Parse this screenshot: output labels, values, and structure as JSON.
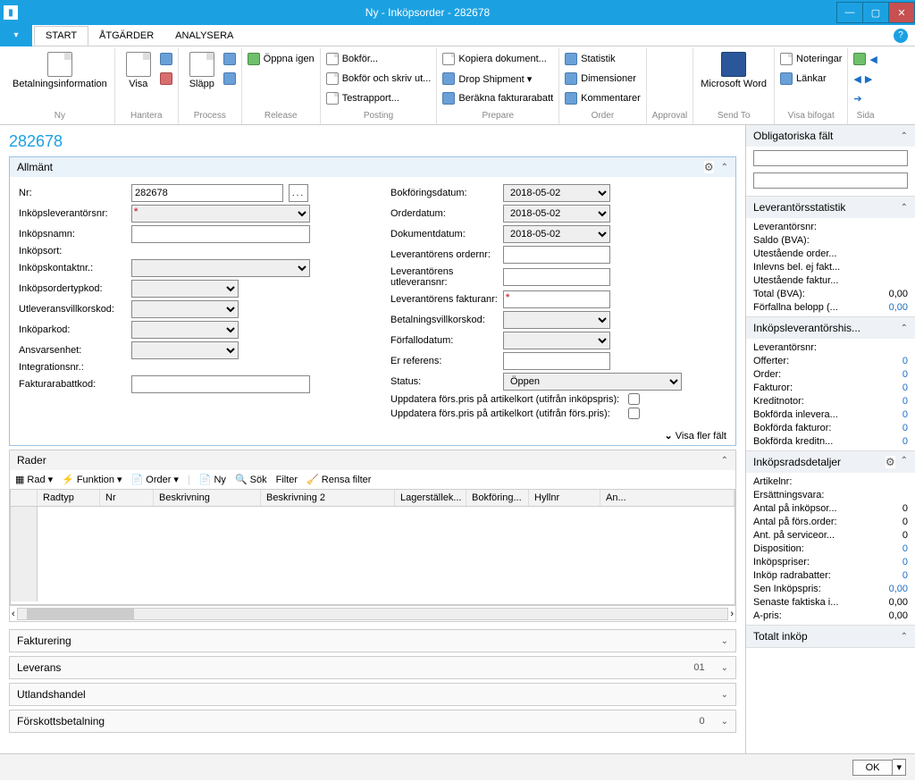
{
  "window": {
    "title": "Ny - Inköpsorder - 282678"
  },
  "tabs": {
    "file": "",
    "start": "START",
    "atgarder": "ÅTGÄRDER",
    "analysera": "ANALYSERA"
  },
  "ribbon": {
    "ny": {
      "label": "Ny",
      "item": "Betalningsinformation"
    },
    "hantera": {
      "label": "Hantera",
      "item": "Visa"
    },
    "process": {
      "label": "Process",
      "item": "Släpp"
    },
    "release": {
      "label": "Release",
      "item": "Öppna igen"
    },
    "posting": {
      "label": "Posting",
      "items": [
        "Bokför...",
        "Bokför och skriv ut...",
        "Testrapport..."
      ]
    },
    "prepare": {
      "label": "Prepare",
      "items": [
        "Kopiera dokument...",
        "Drop Shipment ▾",
        "Beräkna fakturarabatt"
      ]
    },
    "order": {
      "label": "Order",
      "items": [
        "Statistik",
        "Dimensioner",
        "Kommentarer"
      ]
    },
    "approval": {
      "label": "Approval"
    },
    "sendto": {
      "label": "Send To",
      "item": "Microsoft Word"
    },
    "visa": {
      "label": "Visa bifogat",
      "items": [
        "Noteringar",
        "Länkar"
      ]
    },
    "sida": {
      "label": "Sida"
    }
  },
  "page_title": "282678",
  "allmant": {
    "header": "Allmänt",
    "left": {
      "nr": {
        "label": "Nr:",
        "value": "282678"
      },
      "leverantorsnr": {
        "label": "Inköpsleverantörsnr:",
        "value": ""
      },
      "inkopnamn": {
        "label": "Inköpsnamn:",
        "value": ""
      },
      "inkopsort": {
        "label": "Inköpsort:",
        "value": ""
      },
      "inkopkontakt": {
        "label": "Inköpskontaktnr.:",
        "value": ""
      },
      "ordertyp": {
        "label": "Inköpsordertypkod:",
        "value": ""
      },
      "utlev": {
        "label": "Utleveransvillkorskod:",
        "value": ""
      },
      "inkoparkod": {
        "label": "Inköparkod:",
        "value": ""
      },
      "ansvarsenhet": {
        "label": "Ansvarsenhet:",
        "value": ""
      },
      "integration": {
        "label": "Integrationsnr.:",
        "value": ""
      },
      "fakturarabatt": {
        "label": "Fakturarabattkod:",
        "value": ""
      }
    },
    "right": {
      "bokforing": {
        "label": "Bokföringsdatum:",
        "value": "2018-05-02"
      },
      "orderdatum": {
        "label": "Orderdatum:",
        "value": "2018-05-02"
      },
      "dokumentdatum": {
        "label": "Dokumentdatum:",
        "value": "2018-05-02"
      },
      "levorder": {
        "label": "Leverantörens ordernr:",
        "value": ""
      },
      "levutlev": {
        "label": "Leverantörens utleveransnr:",
        "value": ""
      },
      "levfakt": {
        "label": "Leverantörens fakturanr:",
        "value": ""
      },
      "betvillkor": {
        "label": "Betalningsvillkorskod:",
        "value": ""
      },
      "forfallo": {
        "label": "Förfallodatum:",
        "value": ""
      },
      "erref": {
        "label": "Er referens:",
        "value": ""
      },
      "status": {
        "label": "Status:",
        "value": "Öppen"
      },
      "upd1": {
        "label": "Uppdatera förs.pris på artikelkort  (utifrån inköpspris):"
      },
      "upd2": {
        "label": "Uppdatera förs.pris på artikelkort (utifrån förs.pris):"
      }
    },
    "showmore": "Visa fler fält"
  },
  "rader": {
    "header": "Rader",
    "toolbar": {
      "rad": "Rad",
      "funktion": "Funktion",
      "order": "Order",
      "ny": "Ny",
      "sok": "Sök",
      "filter": "Filter",
      "rensa": "Rensa filter"
    },
    "columns": [
      "Radtyp",
      "Nr",
      "Beskrivning",
      "Beskrivning 2",
      "Lagerställek...",
      "Bokföring...",
      "Hyllnr",
      "An..."
    ]
  },
  "collapsed": {
    "fakturering": {
      "label": "Fakturering",
      "badge": ""
    },
    "leverans": {
      "label": "Leverans",
      "badge": "01"
    },
    "utlandshandel": {
      "label": "Utlandshandel",
      "badge": ""
    },
    "forskott": {
      "label": "Förskottsbetalning",
      "badge": "0"
    }
  },
  "side": {
    "obl": {
      "header": "Obligatoriska fält"
    },
    "levstat": {
      "header": "Leverantörsstatistik",
      "rows": [
        {
          "l": "Leverantörsnr:",
          "v": ""
        },
        {
          "l": "Saldo (BVA):",
          "v": ""
        },
        {
          "l": "Utestående order...",
          "v": ""
        },
        {
          "l": "Inlevns bel. ej fakt...",
          "v": ""
        },
        {
          "l": "Utestående faktur...",
          "v": ""
        },
        {
          "l": "Total (BVA):",
          "v": "0,00"
        },
        {
          "l": "Förfallna belopp (...",
          "v": "0,00",
          "blue": true
        }
      ]
    },
    "levhist": {
      "header": "Inköpsleverantörshis...",
      "rows": [
        {
          "l": "Leverantörsnr:",
          "v": ""
        },
        {
          "l": "Offerter:",
          "v": "0",
          "blue": true
        },
        {
          "l": "Order:",
          "v": "0",
          "blue": true
        },
        {
          "l": "Fakturor:",
          "v": "0",
          "blue": true
        },
        {
          "l": "Kreditnotor:",
          "v": "0",
          "blue": true
        },
        {
          "l": "Bokförda inlevera...",
          "v": "0",
          "blue": true
        },
        {
          "l": "Bokförda fakturor:",
          "v": "0",
          "blue": true
        },
        {
          "l": "Bokförda kreditn...",
          "v": "0",
          "blue": true
        }
      ]
    },
    "radsdet": {
      "header": "Inköpsradsdetaljer",
      "rows": [
        {
          "l": "Artikelnr:",
          "v": ""
        },
        {
          "l": "Ersättningsvara:",
          "v": ""
        },
        {
          "l": "Antal på inköpsor...",
          "v": "0"
        },
        {
          "l": "Antal på förs.order:",
          "v": "0"
        },
        {
          "l": "Ant. på serviceor...",
          "v": "0"
        },
        {
          "l": "Disposition:",
          "v": "0",
          "blue": true
        },
        {
          "l": "Inköpspriser:",
          "v": "0",
          "blue": true
        },
        {
          "l": "Inköp radrabatter:",
          "v": "0",
          "blue": true
        },
        {
          "l": "Sen Inköpspris:",
          "v": "0,00",
          "blue": true
        },
        {
          "l": "Senaste faktiska i...",
          "v": "0,00"
        },
        {
          "l": "A-pris:",
          "v": "0,00"
        }
      ]
    },
    "totalt": {
      "header": "Totalt inköp"
    }
  },
  "footer": {
    "ok": "OK"
  }
}
